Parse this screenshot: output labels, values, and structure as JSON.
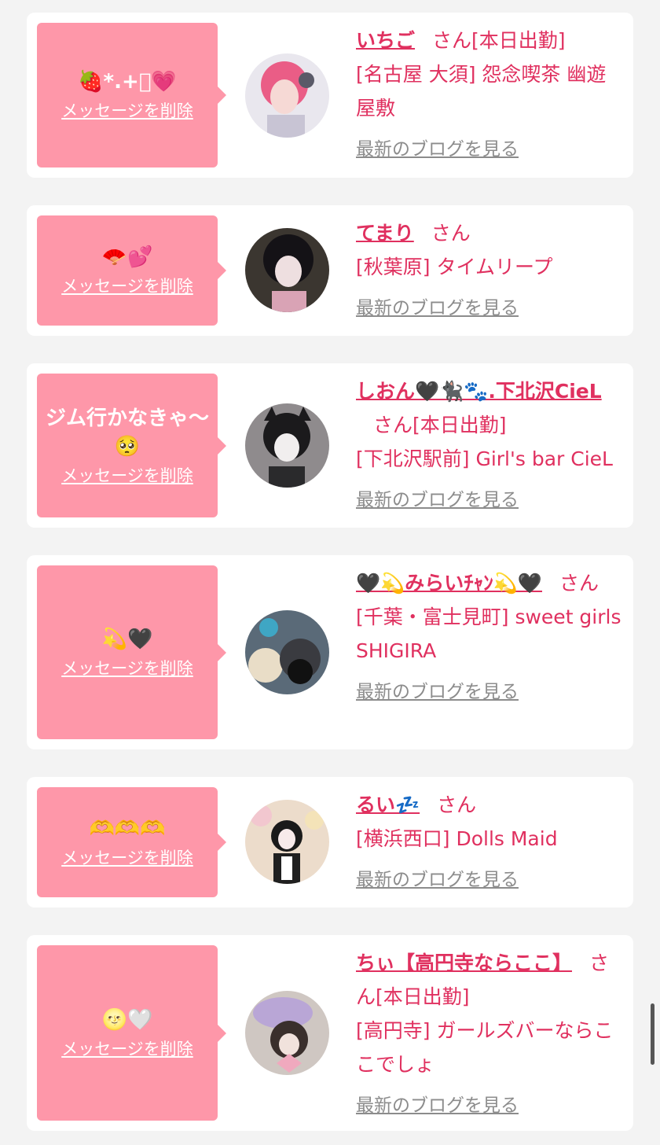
{
  "delete_label": "メッセージを削除",
  "blog_label": "最新のブログを見る",
  "san_label": "さん",
  "colors": {
    "background": "#f3f3f3",
    "bubble": "#fe97a9",
    "accent": "#e0305f",
    "link_gray": "#8c8c8c"
  },
  "entries": [
    {
      "message": "🍓*.+ﾟ💗",
      "name": "いちご",
      "status": "[本日出勤]",
      "shop": "[名古屋 大須] 怨念喫茶 幽遊屋敷",
      "avatar_icon": "avatar-pink-hair-icon"
    },
    {
      "message": "🪭💕",
      "name": "てまり",
      "status": "",
      "shop": "[秋葉原] タイムリープ",
      "avatar_icon": "avatar-black-hair-icon"
    },
    {
      "message": "ジム行かなきゃ〜🥺",
      "name": "しおん🖤🐈‍⬛🐾.下北沢CieL",
      "status": "[本日出勤]",
      "shop": "[下北沢駅前] Girl's bar CieL",
      "avatar_icon": "avatar-cat-ears-icon"
    },
    {
      "message": "💫🖤",
      "name": "🖤💫みらいﾁｬﾝ💫🖤",
      "status": "",
      "shop": "[千葉・富士見町] sweet girls SHIGIRA",
      "avatar_icon": "avatar-plush-icon"
    },
    {
      "message": "🫶🫶🫶",
      "name": "るい💤",
      "status": "",
      "shop": "[横浜西口] Dolls Maid",
      "avatar_icon": "avatar-maid-icon"
    },
    {
      "message": "🌝🤍",
      "name": "ちぃ【高円寺ならここ】",
      "status": "[本日出勤]",
      "shop": "[高円寺] ガールズバーならここでしょ",
      "avatar_icon": "avatar-beret-icon"
    }
  ]
}
